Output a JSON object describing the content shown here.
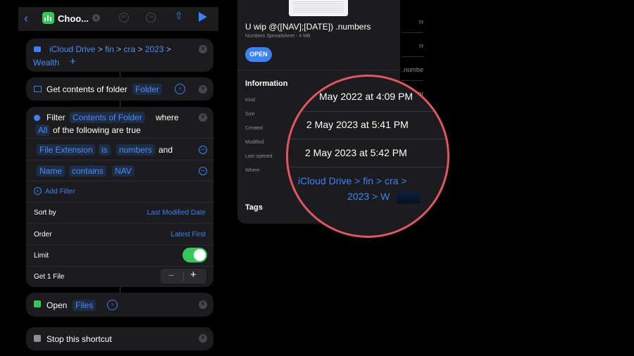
{
  "shortcut": {
    "title": "Choo...",
    "actions": {
      "folder": {
        "path": [
          "iCloud Drive",
          "fin",
          "cra",
          "2023",
          "Wealth"
        ],
        "sep": ">",
        "add_label": "+"
      },
      "get_contents": {
        "label": "Get contents of folder",
        "token": "Folder"
      },
      "filter": {
        "label": "Filter",
        "token": "Contents of Folder",
        "where": "where",
        "all": "All",
        "following": "of the following are true",
        "conditions": [
          {
            "field": "File Extension",
            "op": "is",
            "value": "numbers",
            "joiner": "and"
          },
          {
            "field": "Name",
            "op": "contains",
            "value": "NAV",
            "joiner": ""
          }
        ],
        "add_filter": "Add Filter",
        "sort_by": {
          "label": "Sort by",
          "value": "Last Modified Date"
        },
        "order": {
          "label": "Order",
          "value": "Latest First"
        },
        "limit": {
          "label": "Limit",
          "on": true
        },
        "get": {
          "label": "Get 1 File"
        }
      },
      "open": {
        "label": "Open",
        "token": "Files"
      },
      "stop": {
        "label": "Stop this shortcut"
      }
    }
  },
  "file_info": {
    "filename": "U wip @([NAV];[DATE]) .numbers",
    "subtitle": "Numbers Spreadsheet - 4 MB",
    "open_button": "OPEN",
    "information_heading": "Information",
    "fields": [
      "Kind",
      "Size",
      "Created",
      "Modified",
      "Last opened",
      "Where"
    ],
    "tags_heading": "Tags",
    "background_files": [
      "numbers",
      "numbers",
      ".numbe",
      "mber"
    ]
  },
  "magnifier": {
    "created": "May 2022 at 4:09 PM",
    "modified": "2 May 2023 at 5:41 PM",
    "last_opened": "2 May 2023 at 5:42 PM",
    "where_line1": "iCloud Drive > fin > cra >",
    "where_line2": "2023 > W"
  },
  "colors": {
    "accent": "#3b82f6",
    "toggle": "#34c759",
    "magnifier_ring": "#e25563"
  }
}
